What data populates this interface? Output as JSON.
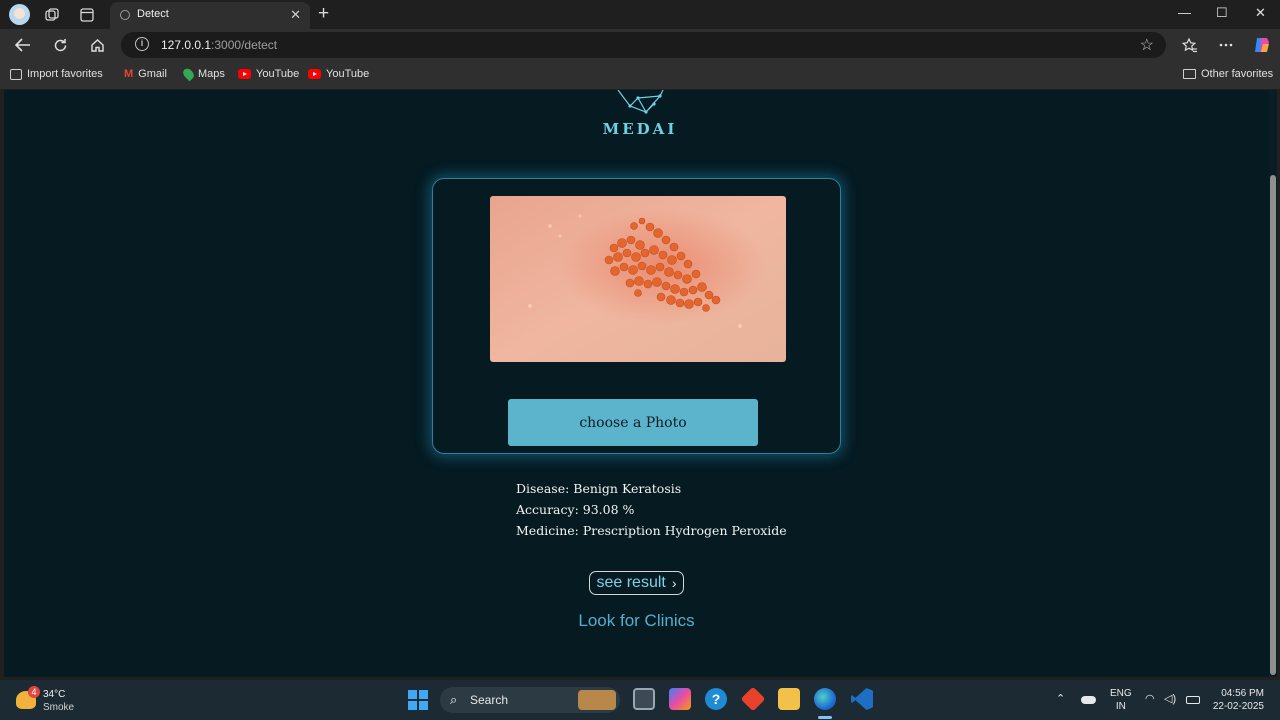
{
  "browser": {
    "tab_title": "Detect",
    "url_host": "127.0.0.1",
    "url_rest": ":3000/detect",
    "favorites": [
      {
        "label": "Import favorites",
        "icon": "import-icon"
      },
      {
        "label": "Gmail",
        "icon": "gmail-icon"
      },
      {
        "label": "Maps",
        "icon": "maps-icon"
      },
      {
        "label": "YouTube",
        "icon": "youtube-icon"
      },
      {
        "label": "YouTube",
        "icon": "youtube-icon"
      }
    ],
    "other_favorites": "Other favorites"
  },
  "page": {
    "logo_text": "MEDAI",
    "choose_label": "choose a Photo",
    "result": {
      "disease_label": "Disease:",
      "disease_value": "Benign Keratosis",
      "accuracy_label": "Accuracy:",
      "accuracy_value": "93.08 %",
      "medicine_label": "Medicine:",
      "medicine_value": "Prescription Hydrogen Peroxide"
    },
    "see_result_label": "see result",
    "clinics_label": "Look for Clinics",
    "accent_color": "#5cb3cc",
    "background_color": "#051a21"
  },
  "taskbar": {
    "weather_badge": "4",
    "temperature": "34°C",
    "condition": "Smoke",
    "search_label": "Search",
    "lang_line1": "ENG",
    "lang_line2": "IN",
    "time": "04:56 PM",
    "date": "22-02-2025"
  }
}
